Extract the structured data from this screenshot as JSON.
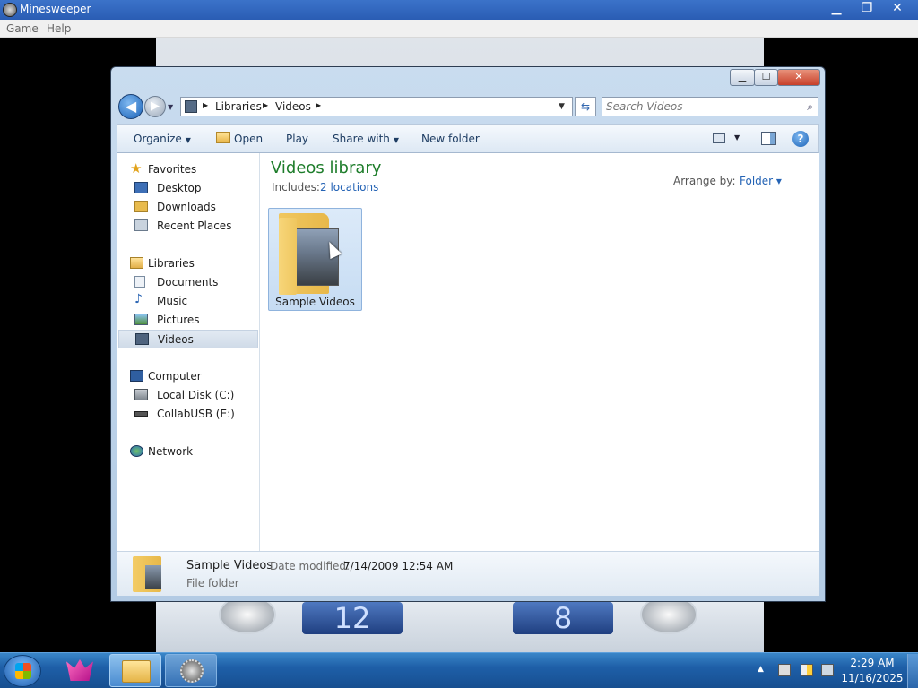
{
  "minesweeper": {
    "title": "Minesweeper",
    "menu": [
      "Game",
      "Help"
    ],
    "controls": {
      "minimize": "▁",
      "restore": "❐",
      "close": "✕"
    },
    "timer": "12",
    "mines": "8"
  },
  "explorer": {
    "captions": {
      "minimize": "▁",
      "maximize": "☐",
      "close": "✕"
    },
    "nav": {
      "back": "◀",
      "forward": "▶",
      "dropdown": "▼"
    },
    "breadcrumbs": [
      "Libraries",
      "Videos"
    ],
    "address_dropdown": "▼",
    "refresh": "⇆",
    "search": {
      "placeholder": "Search Videos",
      "icon": "⌕"
    },
    "toolbar": {
      "organize": "Organize",
      "open": "Open",
      "play": "Play",
      "share_with": "Share with",
      "new_folder": "New folder",
      "view_dropdown": "▼",
      "help": "?"
    },
    "sidebar": {
      "favorites": {
        "label": "Favorites",
        "items": [
          "Desktop",
          "Downloads",
          "Recent Places"
        ]
      },
      "libraries": {
        "label": "Libraries",
        "items": [
          "Documents",
          "Music",
          "Pictures",
          "Videos"
        ]
      },
      "computer": {
        "label": "Computer",
        "items": [
          "Local Disk (C:)",
          "CollabUSB (E:)"
        ]
      },
      "network": {
        "label": "Network"
      }
    },
    "selected_sidebar_item": "Videos",
    "content": {
      "title": "Videos library",
      "includes_label": "Includes:",
      "includes_link": "2 locations",
      "arrange_label": "Arrange by:",
      "arrange_value": "Folder ▾",
      "items": [
        {
          "name": "Sample Videos",
          "type": "folder"
        }
      ]
    },
    "details": {
      "name": "Sample Videos",
      "modified_label": "Date modified:",
      "modified_value": "7/14/2009 12:54 AM",
      "type": "File folder"
    }
  },
  "taskbar": {
    "tray_expand": "▲",
    "time": "2:29 AM",
    "date": "11/16/2025"
  },
  "colors": {
    "library_title": "#1e7d2b",
    "link": "#2463b5",
    "taskbar": "#1e5fa8"
  }
}
